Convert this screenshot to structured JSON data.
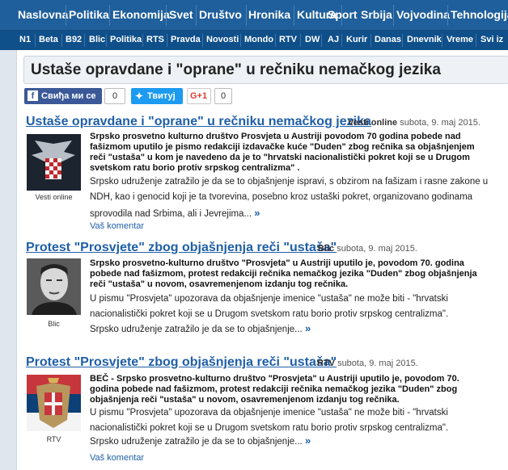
{
  "nav": {
    "main": [
      "Naslovna",
      "Politika",
      "Ekonomija",
      "Svet",
      "Društvo",
      "Hronika",
      "Kultura",
      "Sport",
      "Srbija",
      "Vojvodina",
      "Tehnologija"
    ],
    "sources": [
      "N1",
      "Beta",
      "B92",
      "Blic",
      "Politika",
      "RTS",
      "Pravda",
      "Novosti",
      "Mondo",
      "RTV",
      "DW",
      "AJ",
      "Kurir",
      "Danas",
      "Dnevnik",
      "Vreme",
      "Svi iz"
    ]
  },
  "page": {
    "title": "Ustaše opravdane i \"oprane\" u rečniku nemačkog jezika"
  },
  "share": {
    "facebook_label": "Свиђа ми се",
    "facebook_count": "0",
    "twitter_label": "Твитуј",
    "gplus_label": "G+1",
    "gplus_count": "0"
  },
  "articles": [
    {
      "title": "Ustaše opravdane i \"oprane\" u rečniku nemačkog jezika",
      "source": "Vesti online",
      "date": "subota, 9. maj 2015.",
      "thumb_caption": "Vesti online",
      "lead": "Srpsko prosvetno kulturno društvo Prosvjeta u Austriji povodom 70 godina pobede nad fašizmom uputilo je pismo redakciji izdavačke kuće \"Duden\" zbog rečnika sa objašnjenjem reči \"ustaša\" u kom je navedeno da je to \"hrvatski nacionalistički pokret koji se u Drugom svetskom ratu borio protiv srpskog centralizma\" .",
      "body": "Srpsko udruženje zatražilo je da se to objašnjenje ispravi, s obzirom na fašizam i rasne zakone u NDH, kao i genocid koji je ta tvorevina, posebno kroz ustaški pokret, organizovano godinama sprovodila nad Srbima, ali i Jevrejima...",
      "more": "»",
      "comment": "Vaš komentar"
    },
    {
      "title": "Protest \"Prosvjete\" zbog objašnjenja reči \"ustaša\"",
      "source": "Blic",
      "date": "subota, 9. maj 2015.",
      "thumb_caption": "Blic",
      "lead": "Srpsko prosvetno-kulturno društvo \"Prosvjeta\" u Austriji uputilo je, povodom 70. godina pobede nad fašizmom, protest redakciji rečnika nemačkog jezika \"Duden\" zbog objašnjenja reči \"ustaša\" u novom, osavremenjenom izdanju tog rečnika.",
      "body1": "U pismu \"Prosvjeta\" upozorava da objašnjenje imenice \"ustaša\" ne može biti - \"hrvatski nacionalistički pokret koji se u Drugom svetskom ratu borio protiv srpskog centralizma\".",
      "body2": "Srpsko udruženje zatražilo je da se to objašnjenje...",
      "more": "»"
    },
    {
      "title": "Protest \"Prosvjete\" zbog objašnjenja reči \"ustaša\"",
      "source": "RTV",
      "date": "subota, 9. maj 2015.",
      "thumb_caption": "RTV",
      "lead": "BEČ - Srpsko prosvetno-kulturno društvo \"Prosvjeta\" u Austriji uputilo je, povodom 70. godina pobede nad fašizmom, protest redakciji rečnika nemačkog jezika \"Duden\" zbog objašnjenja reči \"ustaša\" u novom, osavremenjenom izdanju tog rečnika.",
      "body1": "U pismu \"Prosvjeta\" upozorava da objašnjenje imenice \"ustaša\" ne može biti - \"hrvatski nacionalistički pokret koji se u Drugom svetskom ratu borio protiv srpskog centralizma\".",
      "body2": "Srpsko udruženje zatražilo je da se to objašnjenje...",
      "more": "»",
      "comment": "Vaš komentar"
    }
  ],
  "colors": {
    "nav": "#1f5f9c",
    "subnav": "#0f4f8a",
    "link": "#1f5fa8",
    "facebook": "#3b5998",
    "twitter": "#1d9bf0"
  }
}
